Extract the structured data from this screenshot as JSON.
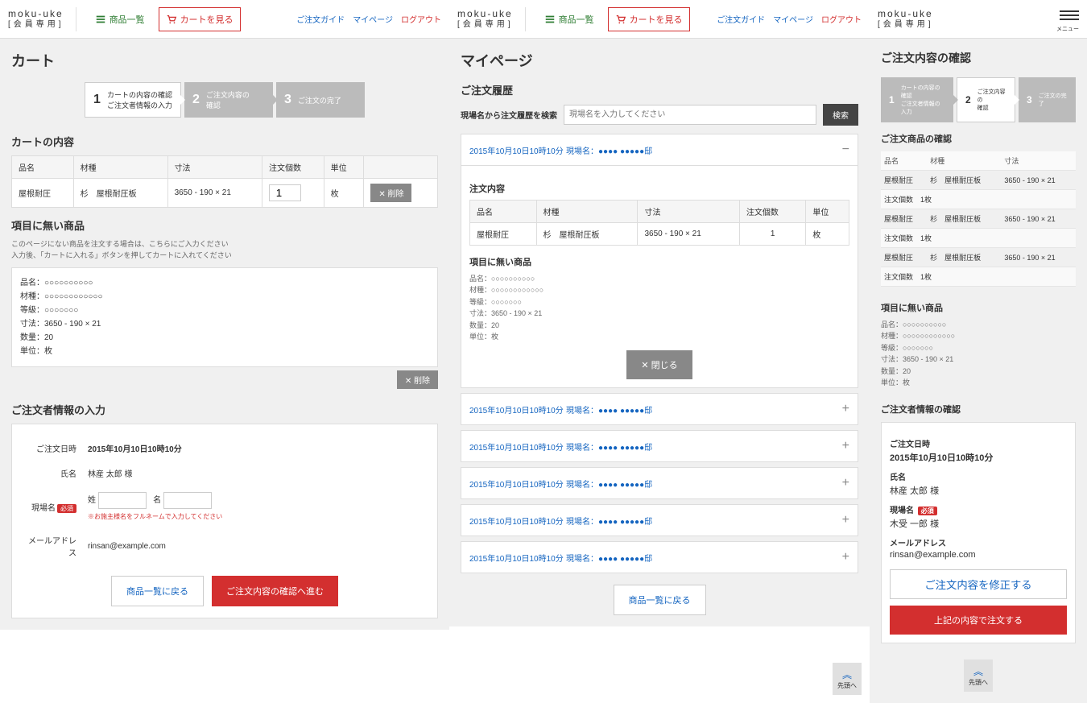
{
  "brand": {
    "name": "moku-uke",
    "sub": "[会員専用]"
  },
  "nav": {
    "products": "商品一覧",
    "cart": "カートを見る",
    "guide": "ご注文ガイド",
    "mypage": "マイページ",
    "logout": "ログアウト",
    "menu": "メニュー"
  },
  "cart": {
    "title": "カート",
    "steps": [
      {
        "num": "1",
        "text": "カートの内容の確認\nご注文者情報の入力"
      },
      {
        "num": "2",
        "text": "ご注文内容の\n確認"
      },
      {
        "num": "3",
        "text": "ご注文の完了"
      }
    ],
    "contents_h": "カートの内容",
    "cols": {
      "name": "品名",
      "type": "材種",
      "size": "寸法",
      "qty": "注文個数",
      "unit": "単位"
    },
    "row": {
      "name": "屋根耐圧",
      "type": "杉　屋根耐圧板",
      "size": "3650 - 190 × 21",
      "qty": "1",
      "unit": "枚"
    },
    "delete": "削除",
    "freeitem_h": "項目に無い商品",
    "freeitem_note1": "このページにない商品を注文する場合は、こちらにご入力ください",
    "freeitem_note2": "入力後、「カートに入れる」ボタンを押してカートに入れてください",
    "free": {
      "name": "品名：○○○○○○○○○○",
      "type": "材種：○○○○○○○○○○○○",
      "grade": "等級：○○○○○○○",
      "size": "寸法：3650 - 190 × 21",
      "qty": "数量：20",
      "unit": "単位：枚"
    },
    "orderer_h": "ご注文者情報の入力",
    "form": {
      "date_lbl": "ご注文日時",
      "date_val": "2015年10月10日10時10分",
      "name_lbl": "氏名",
      "name_val": "林産 太郎 様",
      "site_lbl": "現場名",
      "req": "必須",
      "sei": "姓",
      "mei": "名",
      "site_hint": "※お施主様名をフルネームで入力してください",
      "email_lbl": "メールアドレス",
      "email_val": "rinsan@example.com"
    },
    "btn_back": "商品一覧に戻る",
    "btn_next": "ご注文内容の確認へ進む"
  },
  "mypage": {
    "title": "マイページ",
    "hist_h": "ご注文履歴",
    "search_lbl": "現場名から注文履歴を検索",
    "search_ph": "現場名を入力してください",
    "search_btn": "検索",
    "date": "2015年10月10日10時10分",
    "site": "現場名：●●●● ●●●●●邸",
    "order_h": "注文内容",
    "free_h": "項目に無い商品",
    "close": "閉じる",
    "btn_back": "商品一覧に戻る",
    "backtop": "先頭へ"
  },
  "confirm": {
    "title": "ご注文内容の確認",
    "prod_h": "ご注文商品の確認",
    "qty_lbl": "注文個数　1枚",
    "free_h": "項目に無い商品",
    "orderer_h": "ご注文者情報の確認",
    "date_lbl": "ご注文日時",
    "date_val": "2015年10月10日10時10分",
    "name_lbl": "氏名",
    "name_val": "林産 太郎 様",
    "site_lbl": "現場名",
    "site_val": "木受 一郎 様",
    "email_lbl": "メールアドレス",
    "email_val": "rinsan@example.com",
    "btn_edit": "ご注文内容を修正する",
    "btn_submit": "上記の内容で注文する",
    "backtop": "先頭へ"
  }
}
